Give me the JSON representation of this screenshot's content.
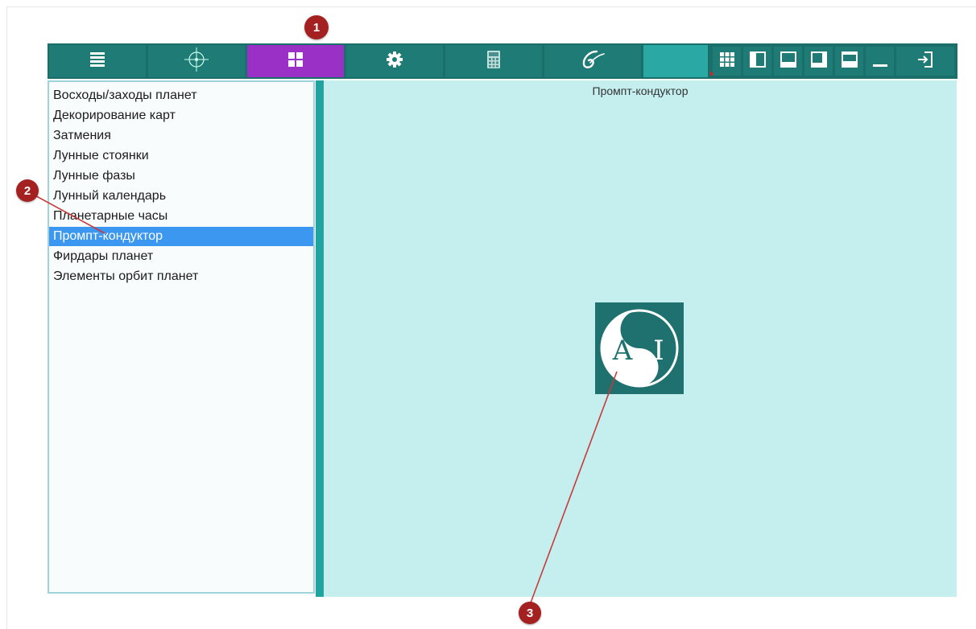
{
  "toolbar": {
    "tools": [
      {
        "name": "menu-list-icon",
        "active": false
      },
      {
        "name": "crosshair-compass-icon",
        "active": false
      },
      {
        "name": "grid-4-squares-icon",
        "active": true
      },
      {
        "name": "gear-icon",
        "active": false
      },
      {
        "name": "calculator-icon",
        "active": false
      },
      {
        "name": "script-glyph-icon",
        "active": false
      }
    ],
    "window_buttons": [
      "grid-9-icon",
      "layout-left-panel-icon",
      "layout-bottom-panel-icon",
      "layout-bottom-right-panel-icon",
      "layout-top-panel-icon",
      "minimize-icon",
      "exit-icon"
    ]
  },
  "sidebar": {
    "items": [
      {
        "label": "Восходы/заходы планет"
      },
      {
        "label": "Декорирование карт"
      },
      {
        "label": "Затмения"
      },
      {
        "label": "Лунные стоянки"
      },
      {
        "label": "Лунные фазы"
      },
      {
        "label": "Лунный календарь"
      },
      {
        "label": "Планетарные часы"
      },
      {
        "label": "Промпт-кондуктор",
        "selected": true
      },
      {
        "label": "Фирдары планет"
      },
      {
        "label": "Элементы орбит планет"
      }
    ]
  },
  "main": {
    "title": "Промпт-кондуктор",
    "logo": {
      "left_letter": "A",
      "right_letter": "I",
      "color": "#1f7170"
    }
  },
  "callouts": [
    "1",
    "2",
    "3"
  ],
  "colors": {
    "toolbar": "#1b6f6a",
    "active_tool": "#9b30c6",
    "selection": "#3b97ef",
    "main_bg": "#c5eeef",
    "callout": "#a52020"
  }
}
